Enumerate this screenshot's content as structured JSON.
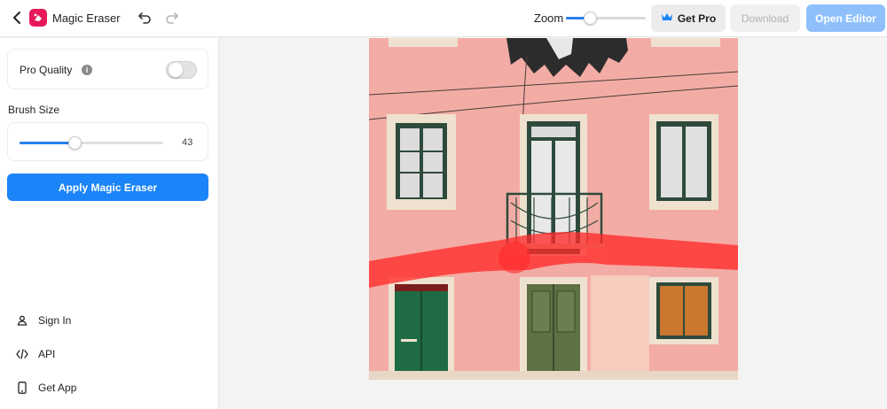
{
  "header": {
    "app_title": "Magic Eraser",
    "zoom_label": "Zoom",
    "zoom_level": 0.3,
    "get_pro_label": "Get Pro",
    "download_label": "Download",
    "open_editor_label": "Open Editor"
  },
  "sidebar": {
    "pro_quality_label": "Pro Quality",
    "pro_quality_enabled": false,
    "brush_size_label": "Brush Size",
    "brush_size_value": "43",
    "brush_size_fraction": 0.38,
    "apply_label": "Apply Magic Eraser",
    "links": [
      {
        "label": "Sign In",
        "icon": "user-icon"
      },
      {
        "label": "API",
        "icon": "code-icon"
      },
      {
        "label": "Get App",
        "icon": "phone-icon"
      }
    ]
  },
  "colors": {
    "accent": "#1b84f8",
    "brand": "#e8195a",
    "mask": "#ff2a2a",
    "wall": "#f2a7a0"
  }
}
